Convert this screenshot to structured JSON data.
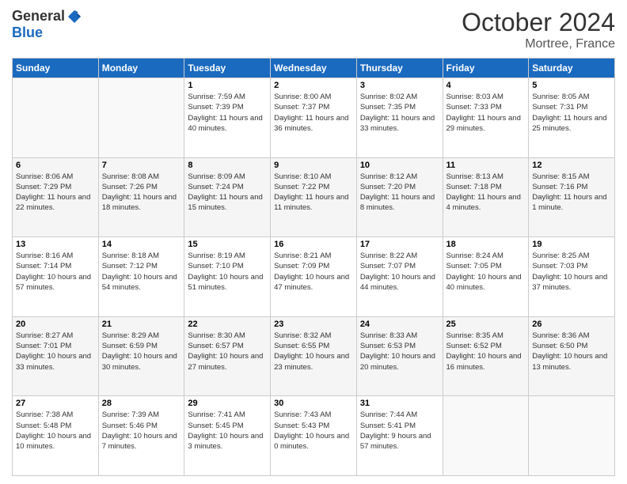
{
  "logo": {
    "general": "General",
    "blue": "Blue"
  },
  "title": "October 2024",
  "location": "Mortree, France",
  "days_of_week": [
    "Sunday",
    "Monday",
    "Tuesday",
    "Wednesday",
    "Thursday",
    "Friday",
    "Saturday"
  ],
  "weeks": [
    [
      {
        "day": "",
        "sunrise": "",
        "sunset": "",
        "daylight": ""
      },
      {
        "day": "",
        "sunrise": "",
        "sunset": "",
        "daylight": ""
      },
      {
        "day": "1",
        "sunrise": "Sunrise: 7:59 AM",
        "sunset": "Sunset: 7:39 PM",
        "daylight": "Daylight: 11 hours and 40 minutes."
      },
      {
        "day": "2",
        "sunrise": "Sunrise: 8:00 AM",
        "sunset": "Sunset: 7:37 PM",
        "daylight": "Daylight: 11 hours and 36 minutes."
      },
      {
        "day": "3",
        "sunrise": "Sunrise: 8:02 AM",
        "sunset": "Sunset: 7:35 PM",
        "daylight": "Daylight: 11 hours and 33 minutes."
      },
      {
        "day": "4",
        "sunrise": "Sunrise: 8:03 AM",
        "sunset": "Sunset: 7:33 PM",
        "daylight": "Daylight: 11 hours and 29 minutes."
      },
      {
        "day": "5",
        "sunrise": "Sunrise: 8:05 AM",
        "sunset": "Sunset: 7:31 PM",
        "daylight": "Daylight: 11 hours and 25 minutes."
      }
    ],
    [
      {
        "day": "6",
        "sunrise": "Sunrise: 8:06 AM",
        "sunset": "Sunset: 7:29 PM",
        "daylight": "Daylight: 11 hours and 22 minutes."
      },
      {
        "day": "7",
        "sunrise": "Sunrise: 8:08 AM",
        "sunset": "Sunset: 7:26 PM",
        "daylight": "Daylight: 11 hours and 18 minutes."
      },
      {
        "day": "8",
        "sunrise": "Sunrise: 8:09 AM",
        "sunset": "Sunset: 7:24 PM",
        "daylight": "Daylight: 11 hours and 15 minutes."
      },
      {
        "day": "9",
        "sunrise": "Sunrise: 8:10 AM",
        "sunset": "Sunset: 7:22 PM",
        "daylight": "Daylight: 11 hours and 11 minutes."
      },
      {
        "day": "10",
        "sunrise": "Sunrise: 8:12 AM",
        "sunset": "Sunset: 7:20 PM",
        "daylight": "Daylight: 11 hours and 8 minutes."
      },
      {
        "day": "11",
        "sunrise": "Sunrise: 8:13 AM",
        "sunset": "Sunset: 7:18 PM",
        "daylight": "Daylight: 11 hours and 4 minutes."
      },
      {
        "day": "12",
        "sunrise": "Sunrise: 8:15 AM",
        "sunset": "Sunset: 7:16 PM",
        "daylight": "Daylight: 11 hours and 1 minute."
      }
    ],
    [
      {
        "day": "13",
        "sunrise": "Sunrise: 8:16 AM",
        "sunset": "Sunset: 7:14 PM",
        "daylight": "Daylight: 10 hours and 57 minutes."
      },
      {
        "day": "14",
        "sunrise": "Sunrise: 8:18 AM",
        "sunset": "Sunset: 7:12 PM",
        "daylight": "Daylight: 10 hours and 54 minutes."
      },
      {
        "day": "15",
        "sunrise": "Sunrise: 8:19 AM",
        "sunset": "Sunset: 7:10 PM",
        "daylight": "Daylight: 10 hours and 51 minutes."
      },
      {
        "day": "16",
        "sunrise": "Sunrise: 8:21 AM",
        "sunset": "Sunset: 7:09 PM",
        "daylight": "Daylight: 10 hours and 47 minutes."
      },
      {
        "day": "17",
        "sunrise": "Sunrise: 8:22 AM",
        "sunset": "Sunset: 7:07 PM",
        "daylight": "Daylight: 10 hours and 44 minutes."
      },
      {
        "day": "18",
        "sunrise": "Sunrise: 8:24 AM",
        "sunset": "Sunset: 7:05 PM",
        "daylight": "Daylight: 10 hours and 40 minutes."
      },
      {
        "day": "19",
        "sunrise": "Sunrise: 8:25 AM",
        "sunset": "Sunset: 7:03 PM",
        "daylight": "Daylight: 10 hours and 37 minutes."
      }
    ],
    [
      {
        "day": "20",
        "sunrise": "Sunrise: 8:27 AM",
        "sunset": "Sunset: 7:01 PM",
        "daylight": "Daylight: 10 hours and 33 minutes."
      },
      {
        "day": "21",
        "sunrise": "Sunrise: 8:29 AM",
        "sunset": "Sunset: 6:59 PM",
        "daylight": "Daylight: 10 hours and 30 minutes."
      },
      {
        "day": "22",
        "sunrise": "Sunrise: 8:30 AM",
        "sunset": "Sunset: 6:57 PM",
        "daylight": "Daylight: 10 hours and 27 minutes."
      },
      {
        "day": "23",
        "sunrise": "Sunrise: 8:32 AM",
        "sunset": "Sunset: 6:55 PM",
        "daylight": "Daylight: 10 hours and 23 minutes."
      },
      {
        "day": "24",
        "sunrise": "Sunrise: 8:33 AM",
        "sunset": "Sunset: 6:53 PM",
        "daylight": "Daylight: 10 hours and 20 minutes."
      },
      {
        "day": "25",
        "sunrise": "Sunrise: 8:35 AM",
        "sunset": "Sunset: 6:52 PM",
        "daylight": "Daylight: 10 hours and 16 minutes."
      },
      {
        "day": "26",
        "sunrise": "Sunrise: 8:36 AM",
        "sunset": "Sunset: 6:50 PM",
        "daylight": "Daylight: 10 hours and 13 minutes."
      }
    ],
    [
      {
        "day": "27",
        "sunrise": "Sunrise: 7:38 AM",
        "sunset": "Sunset: 5:48 PM",
        "daylight": "Daylight: 10 hours and 10 minutes."
      },
      {
        "day": "28",
        "sunrise": "Sunrise: 7:39 AM",
        "sunset": "Sunset: 5:46 PM",
        "daylight": "Daylight: 10 hours and 7 minutes."
      },
      {
        "day": "29",
        "sunrise": "Sunrise: 7:41 AM",
        "sunset": "Sunset: 5:45 PM",
        "daylight": "Daylight: 10 hours and 3 minutes."
      },
      {
        "day": "30",
        "sunrise": "Sunrise: 7:43 AM",
        "sunset": "Sunset: 5:43 PM",
        "daylight": "Daylight: 10 hours and 0 minutes."
      },
      {
        "day": "31",
        "sunrise": "Sunrise: 7:44 AM",
        "sunset": "Sunset: 5:41 PM",
        "daylight": "Daylight: 9 hours and 57 minutes."
      },
      {
        "day": "",
        "sunrise": "",
        "sunset": "",
        "daylight": ""
      },
      {
        "day": "",
        "sunrise": "",
        "sunset": "",
        "daylight": ""
      }
    ]
  ]
}
